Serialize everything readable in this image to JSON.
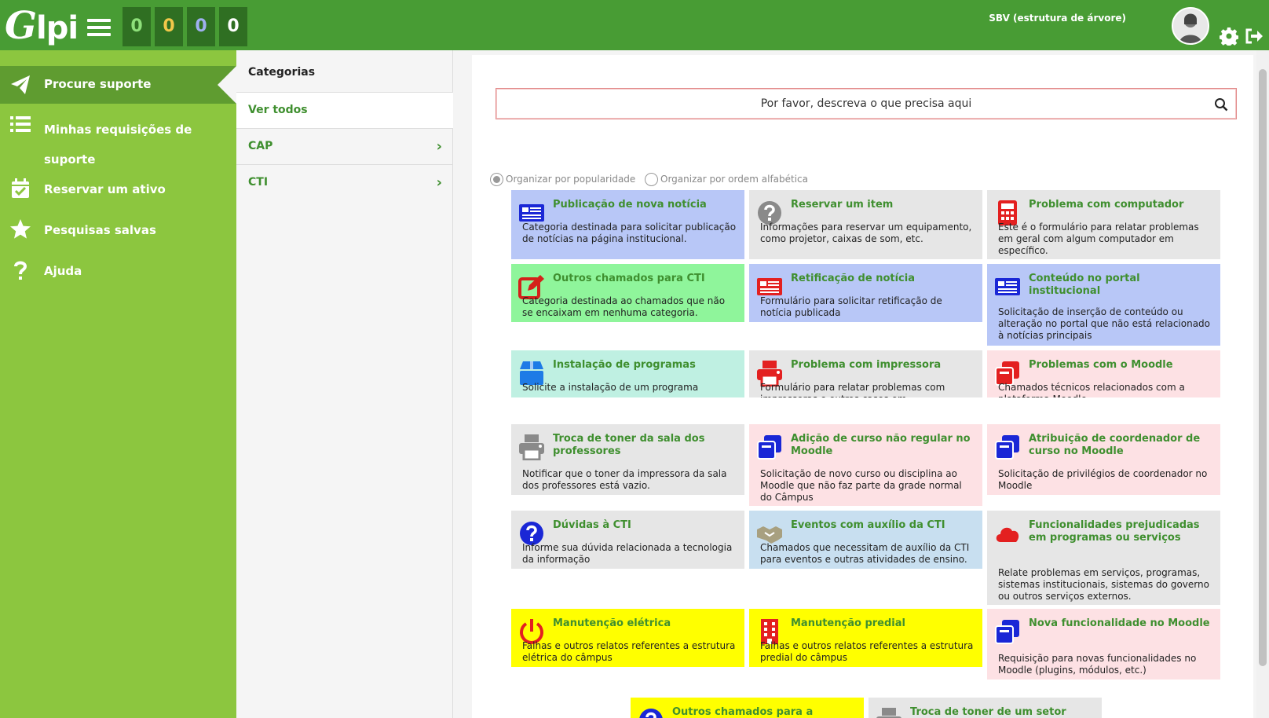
{
  "header": {
    "logo_text": "Glpi",
    "counters": [
      {
        "value": "0",
        "color": "#8ee07a"
      },
      {
        "value": "0",
        "color": "#f1c84a"
      },
      {
        "value": "0",
        "color": "#9fb0f0"
      },
      {
        "value": "0",
        "color": "#ffffff"
      }
    ],
    "user_name": "SBV (estrutura de árvore)"
  },
  "sidebar": {
    "items": [
      {
        "label": "Procure suporte",
        "icon": "paper-plane-icon"
      },
      {
        "label": "Minhas requisições de suporte",
        "icon": "list-icon"
      },
      {
        "label": "Reservar um ativo",
        "icon": "calendar-check-icon"
      },
      {
        "label": "Pesquisas salvas",
        "icon": "star-icon"
      },
      {
        "label": "Ajuda",
        "icon": "question-icon"
      }
    ]
  },
  "categories": {
    "title": "Categorias",
    "items": [
      {
        "label": "Ver todos"
      },
      {
        "label": "CAP"
      },
      {
        "label": "CTI"
      }
    ]
  },
  "search": {
    "placeholder": "Por favor, descreva o que precisa aqui"
  },
  "sort": {
    "popularity": "Organizar por popularidade",
    "alphabetical": "Organizar por ordem alfabética",
    "selected": "popularity"
  },
  "cards": [
    {
      "title": "Publicação de nova notícia",
      "desc": "Categoria destinada para solicitar publicação de notícias na página institucional.",
      "icon": "newspaper-icon",
      "bg": "#b8c7f7",
      "icon_color": "#1a27d6"
    },
    {
      "title": "Reservar um item",
      "desc": "Informações para reservar um equipamento, como projetor, caixas de som, etc.",
      "icon": "question-circle-icon",
      "bg": "#e6e6e6",
      "icon_color": "#8a8a8a"
    },
    {
      "title": "Problema com computador",
      "desc": "Este é o formulário para relatar problemas em geral com algum computador em específico.",
      "icon": "calculator-icon",
      "bg": "#e6e6e6",
      "icon_color": "#e32020"
    },
    {
      "title": "Outros chamados para CTI",
      "desc": "Categoria destinada ao chamados que não se encaixam em nenhuma categoria.",
      "icon": "edit-icon",
      "bg": "#8ff59b",
      "icon_color": "#d4211a"
    },
    {
      "title": "Retificação de notícia",
      "desc": "Formulário para solicitar retificação de notícia publicada",
      "icon": "newspaper-icon",
      "bg": "#b8c7f7",
      "icon_color": "#e32020"
    },
    {
      "title": "Conteúdo no portal institucional",
      "desc": "Solicitação de inserção de conteúdo ou alteração no portal que não está relacionado à notícias principais",
      "icon": "newspaper-icon",
      "bg": "#b8c7f7",
      "icon_color": "#1a27d6"
    },
    {
      "title": "Instalação de programas",
      "desc": "Solicite a instalação de um programa",
      "icon": "box-icon",
      "bg": "#bff0e2",
      "icon_color": "#1e7be6"
    },
    {
      "title": "Problema com impressora",
      "desc": "Formulário para relatar problemas com impressoras e outros casos em multifuncionais",
      "icon": "printer-icon",
      "bg": "#e6e6e6",
      "icon_color": "#e32020"
    },
    {
      "title": "Problemas com o Moodle",
      "desc": "Chamados técnicos relacionados com a plataforma Moodle",
      "icon": "clone-icon",
      "bg": "#fde1e4",
      "icon_color": "#e32020"
    },
    {
      "title": "Troca de toner da sala dos professores",
      "desc": "Notificar que o toner da impressora da sala dos professores está vazio.",
      "icon": "printer-icon",
      "bg": "#e6e6e6",
      "icon_color": "#8a8a8a"
    },
    {
      "title": "Adição de curso não regular no Moodle",
      "desc": "Solicitação de novo curso ou disciplina ao Moodle que não faz parte da grade normal do Câmpus",
      "icon": "clone-icon",
      "bg": "#fde1e4",
      "icon_color": "#1a27d6"
    },
    {
      "title": "Atribuição de coordenador de curso no Moodle",
      "desc": "Solicitação de privilégios de coordenador no Moodle",
      "icon": "clone-icon",
      "bg": "#fde1e4",
      "icon_color": "#1a27d6"
    },
    {
      "title": "Dúvidas à CTI",
      "desc": "Informe sua dúvida relacionada a tecnologia da informação",
      "icon": "question-circle-icon",
      "bg": "#e6e6e6",
      "icon_color": "#1a27d6"
    },
    {
      "title": "Eventos com auxílio da CTI",
      "desc": "Chamados que necessitam de auxílio da CTI para eventos e outras atividades de ensino.",
      "icon": "handshake-icon",
      "bg": "#c8dff0",
      "icon_color": "#a8a080"
    },
    {
      "title": "Funcionalidades prejudicadas em programas ou serviços",
      "desc": "Relate problemas em serviços, programas, sistemas institucionais, sistemas do governo ou outros serviços externos.",
      "icon": "cloud-icon",
      "bg": "#e6e6e6",
      "icon_color": "#e32020"
    },
    {
      "title": "Manutenção elétrica",
      "desc": "Falhas e outros relatos referentes a estrutura elétrica do câmpus",
      "icon": "power-icon",
      "bg": "#ffff00",
      "icon_color": "#e32020"
    },
    {
      "title": "Manutenção predial",
      "desc": "Falhas e outros relatos referentes a estrutura predial do câmpus",
      "icon": "building-icon",
      "bg": "#ffff00",
      "icon_color": "#e32020"
    },
    {
      "title": "Nova funcionalidade no Moodle",
      "desc": "Requisição para novas funcionalidades no Moodle (plugins, módulos, etc.)",
      "icon": "clone-icon",
      "bg": "#fde1e4",
      "icon_color": "#1a27d6"
    },
    {
      "title": "Outros chamados para a",
      "desc": "",
      "icon": "question-circle-icon",
      "bg": "#ffff00",
      "icon_color": "#1a27d6"
    },
    {
      "title": "Troca de toner de um setor",
      "desc": "",
      "icon": "printer-icon",
      "bg": "#e6e6e6",
      "icon_color": "#8a8a8a"
    }
  ]
}
